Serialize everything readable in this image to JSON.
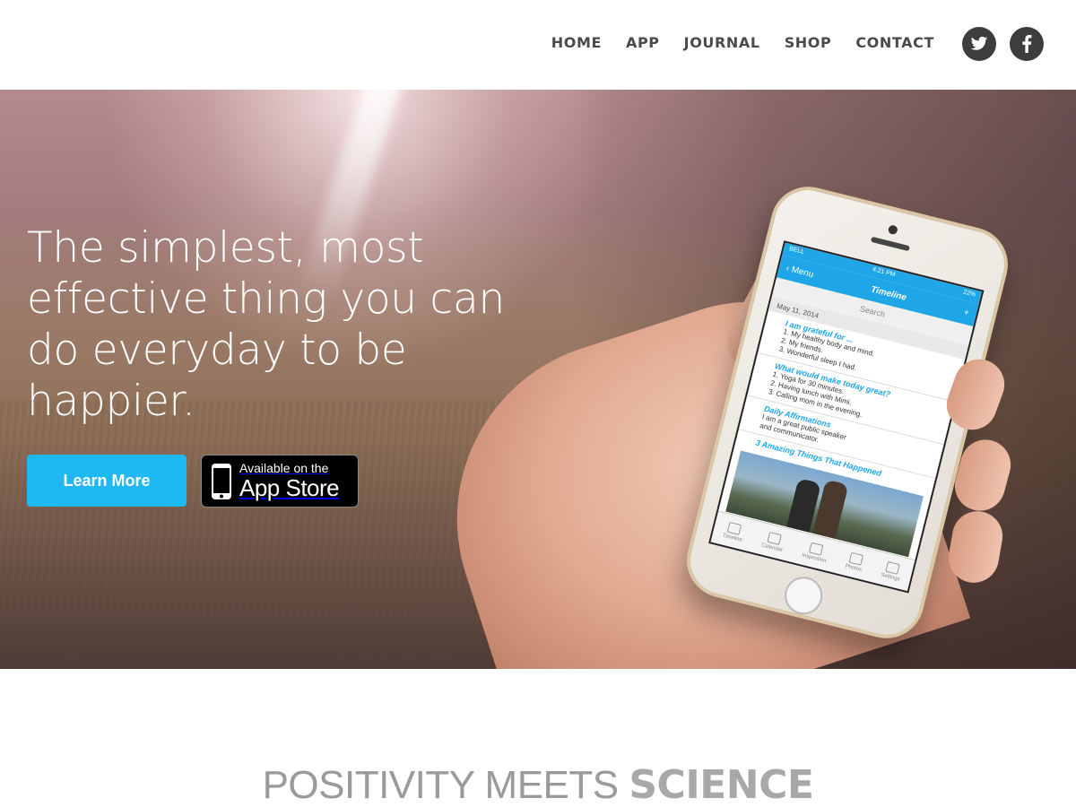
{
  "header": {
    "nav": [
      "HOME",
      "APP",
      "JOURNAL",
      "SHOP",
      "CONTACT"
    ],
    "social": {
      "twitter_icon": "twitter-icon",
      "facebook_icon": "facebook-icon"
    }
  },
  "hero": {
    "headline": "The simplest, most effective thing you can do everyday to be happier.",
    "learn_more": "Learn More",
    "app_store": {
      "small": "Available on the",
      "big": "App Store"
    }
  },
  "phone_screen": {
    "status_left": "BELL",
    "status_time": "4:21 PM",
    "status_right": "22%",
    "menu": "Menu",
    "title": "Timeline",
    "plus": "+",
    "search": "Search",
    "date": "May 11, 2014",
    "entries": [
      {
        "heading": "I am grateful for ...",
        "lines": [
          "1. My healthy body and mind.",
          "2. My friends.",
          "3. Wonderful sleep I had."
        ]
      },
      {
        "heading": "What would make today great?",
        "lines": [
          "1. Yoga for 30 minutes.",
          "2. Having lunch with Mimi.",
          "3. Calling mom in the evening."
        ]
      },
      {
        "heading": "Daily Affirmations",
        "lines": [
          "I am a great public speaker",
          "and communicator."
        ]
      },
      {
        "heading": "3 Amazing Things That Happened",
        "lines": []
      }
    ],
    "tabs": [
      "Timeline",
      "Calendar",
      "Inspiration",
      "Photos",
      "Settings"
    ]
  },
  "section": {
    "title_light": "POSITIVITY MEETS ",
    "title_bold": "SCIENCE"
  },
  "colors": {
    "accent": "#1eb8f2",
    "nav_text": "#4a4a4a",
    "social_bg": "#3d3d3d"
  }
}
